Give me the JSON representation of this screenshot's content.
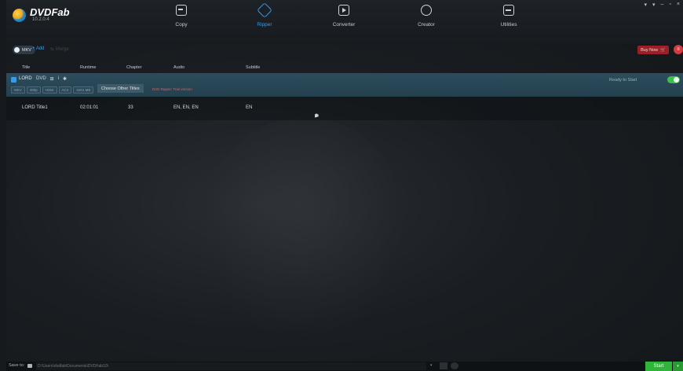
{
  "app": {
    "name": "DVDFab",
    "version": "10.2.0.4"
  },
  "window_controls": [
    "▾",
    "▾",
    "–",
    "▫",
    "×"
  ],
  "nav": [
    {
      "label": "Copy",
      "active": false
    },
    {
      "label": "Ripper",
      "active": true
    },
    {
      "label": "Converter",
      "active": false
    },
    {
      "label": "Creator",
      "active": false
    },
    {
      "label": "Utilities",
      "active": false
    }
  ],
  "actions": {
    "profile_label": "MKV",
    "add_label": "+ Add",
    "merge_label": "⇆ Merge",
    "buy_now_label": "Buy Now"
  },
  "columns": {
    "title": "Title",
    "runtime": "Runtime",
    "chapter": "Chapter",
    "audio": "Audio",
    "subtitle": "Subtitle"
  },
  "source": {
    "title": "LORD",
    "icons": [
      "DVD",
      "⊞",
      "i",
      "✱"
    ],
    "chips": [
      "MKV",
      "480p",
      "H264",
      "AC3",
      "2201 MB"
    ],
    "choose_label": "Choose Other Titles",
    "trial_note": "DVD Ripper: Trial version",
    "status": "Ready to Start"
  },
  "titles": [
    {
      "name": "LORD Title1",
      "runtime": "02:01:01",
      "chapter": "33",
      "audio": "EN, EN, EN",
      "subtitle": "EN"
    }
  ],
  "title_actions": [
    "▶",
    "✎",
    "⚙",
    "✱"
  ],
  "bottom": {
    "save_to_label": "Save to:",
    "save_path": "D:\\Users\\dvdfab\\Documents\\DVDFab10\\",
    "start_label": "Start"
  },
  "colors": {
    "accent": "#3b9be0",
    "start": "#2fb53a",
    "buy_now": "#9a1f26"
  }
}
